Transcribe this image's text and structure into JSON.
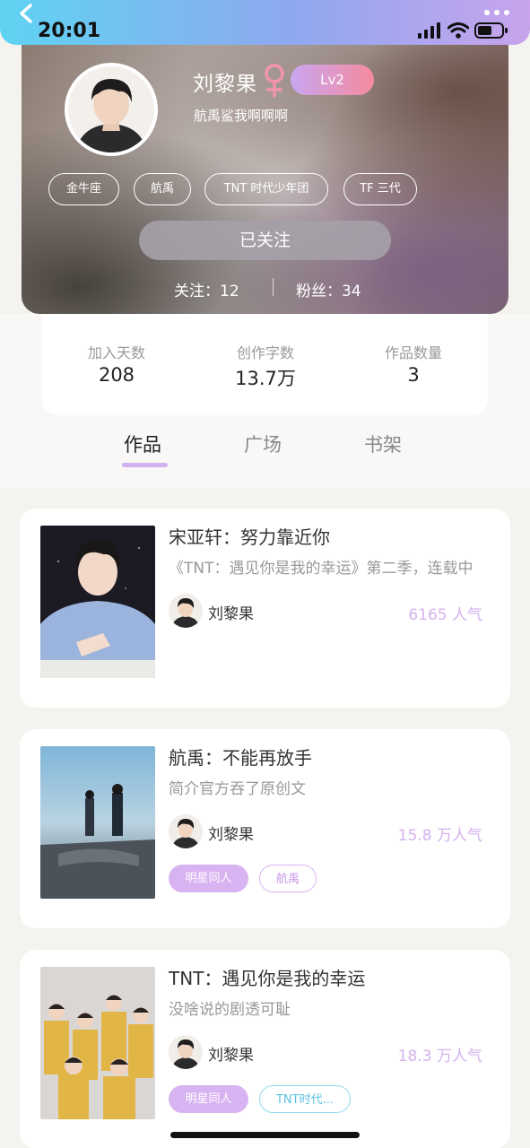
{
  "status_bar": {
    "time": "20:01"
  },
  "profile": {
    "name": "刘黎果",
    "level": "Lv2",
    "bio": "航禹鲨我啊啊啊",
    "tags": [
      "金牛座",
      "航禹",
      "TNT 时代少年团",
      "TF 三代"
    ],
    "follow_label": "已关注",
    "following": "关注：12",
    "fans": "粉丝：34"
  },
  "summary": [
    {
      "label": "加入天数",
      "value": "208"
    },
    {
      "label": "创作字数",
      "value": "13.7万"
    },
    {
      "label": "作品数量",
      "value": "3"
    }
  ],
  "tabs": [
    "作品",
    "广场",
    "书架"
  ],
  "works": [
    {
      "title": "宋亚轩：努力靠近你",
      "desc": "《TNT：遇见你是我的幸运》第二季，连载中",
      "author": "刘黎果",
      "popularity": "6165 人气",
      "tags": []
    },
    {
      "title": "航禹：不能再放手",
      "desc": "简介官方吞了原创文",
      "author": "刘黎果",
      "popularity": "15.8 万人气",
      "tags": [
        "明星同人",
        "航禹"
      ]
    },
    {
      "title": "TNT：遇见你是我的幸运",
      "desc": "没啥说的剧透可耻",
      "author": "刘黎果",
      "popularity": "18.3 万人气",
      "tags": [
        "明星同人",
        "TNT时代..."
      ]
    }
  ],
  "colors": {
    "header_gradient_start": "#5fd3f2",
    "header_gradient_end": "#c8a4ec",
    "accent_purple": "#d8b3f1",
    "level_pink": "#f58a9d",
    "tag_cyan": "#8fd9ee"
  },
  "icons": [
    "back-icon",
    "more-icon",
    "signal-icon",
    "wifi-icon",
    "battery-icon",
    "female-icon"
  ]
}
